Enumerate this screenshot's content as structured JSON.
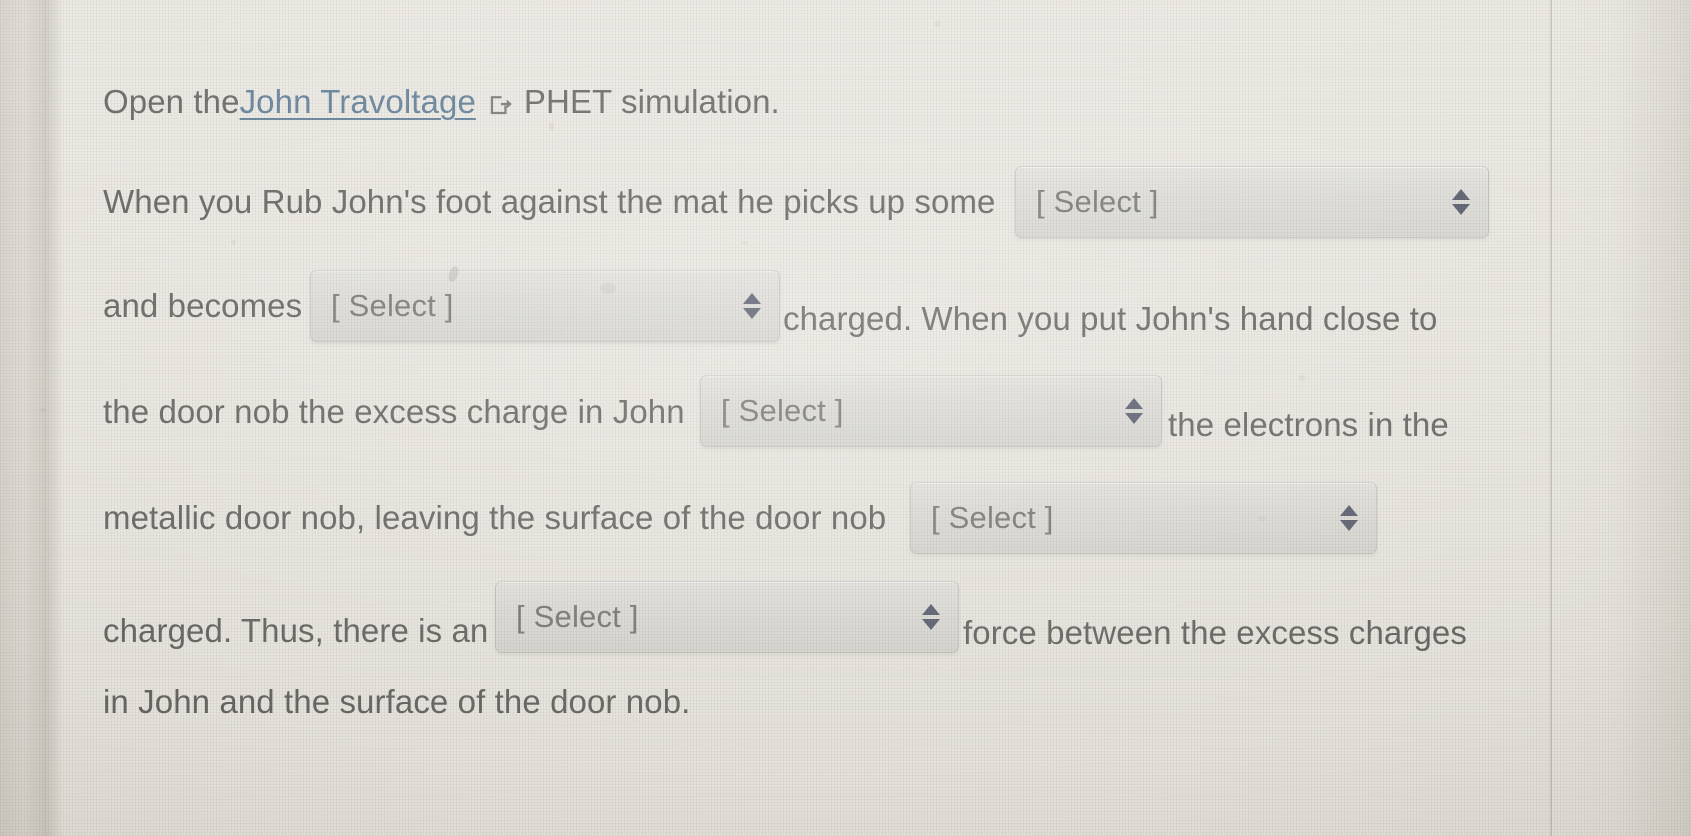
{
  "document": {
    "type": "online-homework-question",
    "background_color": "#e9e6df",
    "text_color": "#575654",
    "link_color": "#4e7291",
    "select_arrow_color": "#4a4f63"
  },
  "question": {
    "line1": {
      "before_link": "Open the ",
      "link_text": "John Travoltage",
      "link_icon": "external-link-icon",
      "after_link": "PHET simulation."
    },
    "line2": {
      "text_before": "When you Rub John's foot against the mat he picks up some",
      "select": "[ Select ]"
    },
    "line3": {
      "text_before": "and becomes",
      "select": "[ Select ]",
      "text_after": "charged.  When you put John's hand close to"
    },
    "line4": {
      "text_before": "the door nob the excess charge in John",
      "select": "[ Select ]",
      "text_after": "the electrons in the"
    },
    "line5": {
      "text_before": "metallic door nob, leaving the surface of the door nob",
      "select": "[ Select ]"
    },
    "line6": {
      "text_before": "charged. Thus, there is an",
      "select": "[ Select ]",
      "text_after": "force between the excess charges"
    },
    "line7": {
      "text": "in John and the surface of the door nob."
    }
  },
  "selects": [
    {
      "id": "select-1",
      "value": "[ Select ]",
      "arrow": "updown-stepper-icon"
    },
    {
      "id": "select-2",
      "value": "[ Select ]",
      "arrow": "updown-stepper-icon"
    },
    {
      "id": "select-3",
      "value": "[ Select ]",
      "arrow": "updown-stepper-icon"
    },
    {
      "id": "select-4",
      "value": "[ Select ]",
      "arrow": "updown-stepper-icon"
    },
    {
      "id": "select-5",
      "value": "[ Select ]",
      "arrow": "updown-stepper-icon"
    }
  ]
}
